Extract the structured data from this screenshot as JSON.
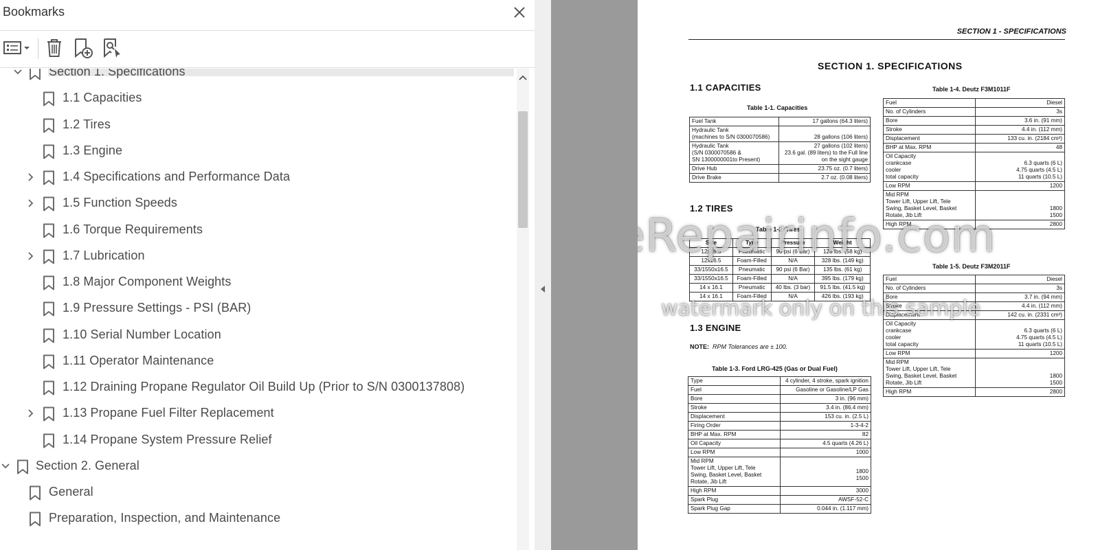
{
  "panel": {
    "title": "Bookmarks",
    "toolbar": {
      "options_icon": "options-list-icon",
      "delete_icon": "trash-icon",
      "new_bookmark_icon": "new-bookmark-icon",
      "find_bookmark_icon": "find-bookmark-icon"
    },
    "tree": [
      {
        "label": "Section 1. Specifications",
        "level": 1,
        "expander": "expanded"
      },
      {
        "label": "1.1 Capacities",
        "level": 2,
        "expander": "none"
      },
      {
        "label": "1.2 Tires",
        "level": 2,
        "expander": "none"
      },
      {
        "label": "1.3 Engine",
        "level": 2,
        "expander": "none"
      },
      {
        "label": "1.4 Specifications and Performance Data",
        "level": 2,
        "expander": "collapsed"
      },
      {
        "label": "1.5 Function Speeds",
        "level": 2,
        "expander": "collapsed"
      },
      {
        "label": "1.6 Torque Requirements",
        "level": 2,
        "expander": "none"
      },
      {
        "label": "1.7 Lubrication",
        "level": 2,
        "expander": "collapsed"
      },
      {
        "label": "1.8 Major Component Weights",
        "level": 2,
        "expander": "none"
      },
      {
        "label": "1.9 Pressure Settings - PSI (BAR)",
        "level": 2,
        "expander": "none"
      },
      {
        "label": "1.10 Serial Number Location",
        "level": 2,
        "expander": "none"
      },
      {
        "label": "1.11 Operator Maintenance",
        "level": 2,
        "expander": "none"
      },
      {
        "label": "1.12 Draining Propane Regulator Oil Build Up (Prior to S/N 0300137808)",
        "level": 2,
        "expander": "none"
      },
      {
        "label": "1.13 Propane Fuel Filter Replacement",
        "level": 2,
        "expander": "collapsed"
      },
      {
        "label": "1.14 Propane System Pressure Relief",
        "level": 2,
        "expander": "none"
      },
      {
        "label": "Section 2. General",
        "level": 0,
        "expander": "expanded"
      },
      {
        "label": "General",
        "level": 1,
        "expander": "none"
      },
      {
        "label": "Preparation, Inspection, and Maintenance",
        "level": 1,
        "expander": "none"
      }
    ]
  },
  "doc": {
    "running_head": "SECTION 1 - SPECIFICATIONS",
    "section_title": "SECTION 1.  SPECIFICATIONS",
    "h_capacities": "1.1   CAPACITIES",
    "h_tires": "1.2   TIRES",
    "h_engine": "1.3   ENGINE",
    "note": "NOTE:  RPM Tolerances are ± 100.",
    "note_label": "NOTE:",
    "note_text": "RPM Tolerances are ± 100.",
    "t1_caption": "Table 1-1. Capacities",
    "t1_rows": [
      [
        "Fuel Tank",
        "17 gallons (64.3 liters)"
      ],
      [
        "Hydraulic Tank\n(machines to S/N 0300070586)",
        "\n28 gallons (106 liters)"
      ],
      [
        "Hydraulic Tank\n(S/N 0300070586 &\nSN 1300000001to Present)",
        "27 gallons (102 liters)\n23.6 gal. (89 liters) to the Full line\non the sight gauge"
      ],
      [
        "Drive Hub",
        "23.75 oz. (0.7 liters)"
      ],
      [
        "Drive Brake",
        "2.7 oz. (0.08 liters)"
      ]
    ],
    "t2_caption": "Table 1-2. Tires",
    "t2_header": [
      "Size",
      "Type",
      "Pressure",
      "Weight"
    ],
    "t2_rows": [
      [
        "12x16.5",
        "Pneumatic",
        "90 psi (6 Bar)",
        "128 lbs. (58 kg)"
      ],
      [
        "12x16.5",
        "Foam-Filled",
        "N/A",
        "328 lbs. (149 kg)"
      ],
      [
        "33/1550x16.5",
        "Pneumatic",
        "90 psi (6 Bar)",
        "135 lbs. (61 kg)"
      ],
      [
        "33/1550x16.5",
        "Foam-Filled",
        "N/A",
        "395 lbs. (179 kg)"
      ],
      [
        "14 x 16.1",
        "Pneumatic",
        "40 lbs. (3 bar)",
        "91.5 lbs. (41.5 kg)"
      ],
      [
        "14 x 16.1",
        "Foam-Filled",
        "N/A",
        "426 lbs. (193 kg)"
      ]
    ],
    "t3_caption": "Table 1-3. Ford LRG-425 (Gas or Dual Fuel)",
    "t3_rows": [
      [
        "Type",
        "4 cylinder, 4 stroke, spark ignition"
      ],
      [
        "Fuel",
        "Gasoline or Gasoline/LP Gas"
      ],
      [
        "Bore",
        "3 in. (96 mm)"
      ],
      [
        "Stroke",
        "3.4 in. (86.4 mm)"
      ],
      [
        "Displacement",
        "153 cu. in. (2.5 L)"
      ],
      [
        "Firing Order",
        "1-3-4-2"
      ],
      [
        "BHP at Max. RPM",
        "82"
      ],
      [
        "Oil Capacity",
        "4.5 quarts (4.26 L)"
      ],
      [
        "Low RPM",
        "1000"
      ],
      [
        "Mid RPM\n   Tower Lift, Upper Lift, Tele\n   Swing, Basket Level, Basket\nRotate, Jib Lift",
        "\n1800\n1500\n"
      ],
      [
        "High RPM",
        "3000"
      ],
      [
        "Spark Plug",
        "AWSF-52-C"
      ],
      [
        "Spark Plug Gap",
        "0.044 in. (1.117 mm)"
      ]
    ],
    "t4_caption": "Table 1-4. Deutz F3M1011F",
    "t4_rows": [
      [
        "Fuel",
        "Diesel"
      ],
      [
        "No. of Cylinders",
        "3s"
      ],
      [
        "Bore",
        "3.6 in. (91 mm)"
      ],
      [
        "Stroke",
        "4.4 in. (112 mm)"
      ],
      [
        "Displacement",
        "133 cu. in. (2184 cm³)"
      ],
      [
        "BHP at Max. RPM",
        "48"
      ],
      [
        "Oil Capacity\n   crankcase\n   cooler\n   total capacity",
        "\n6.3 quarts (6 L)\n4.75 quarts (4.5 L)\n11 quarts (10.5 L)"
      ],
      [
        "Low RPM",
        "1200"
      ],
      [
        "Mid RPM\n   Tower Lift, Upper Lift, Tele\n   Swing, Basket Level, Basket\nRotate, Jib Lift",
        "\n\n1800\n1500"
      ],
      [
        "High RPM",
        "2800"
      ]
    ],
    "t5_caption": "Table 1-5. Deutz F3M2011F",
    "t5_rows": [
      [
        "Fuel",
        "Diesel"
      ],
      [
        "No. of Cylinders",
        "3s"
      ],
      [
        "Bore",
        "3.7 in. (94 mm)"
      ],
      [
        "Stroke",
        "4.4 in. (112 mm)"
      ],
      [
        "Displacement",
        "142 cu. in. (2331 cm³)"
      ],
      [
        "Oil Capacity\n   crankcase\n   cooler\n   total capacity",
        "\n6.3 quarts (6 L)\n4.75 quarts (4.5 L)\n11 quarts (10.5 L)"
      ],
      [
        "Low RPM",
        "1200"
      ],
      [
        "Mid RPM\n   Tower Lift, Upper Lift, Tele\n   Swing, Basket Level, Basket\nRotate, Jib Lift",
        "\n\n1800\n1500"
      ],
      [
        "High RPM",
        "2800"
      ]
    ],
    "watermark_main": "eRepairinfo.com",
    "watermark_sub": "watermark only on this sample"
  }
}
